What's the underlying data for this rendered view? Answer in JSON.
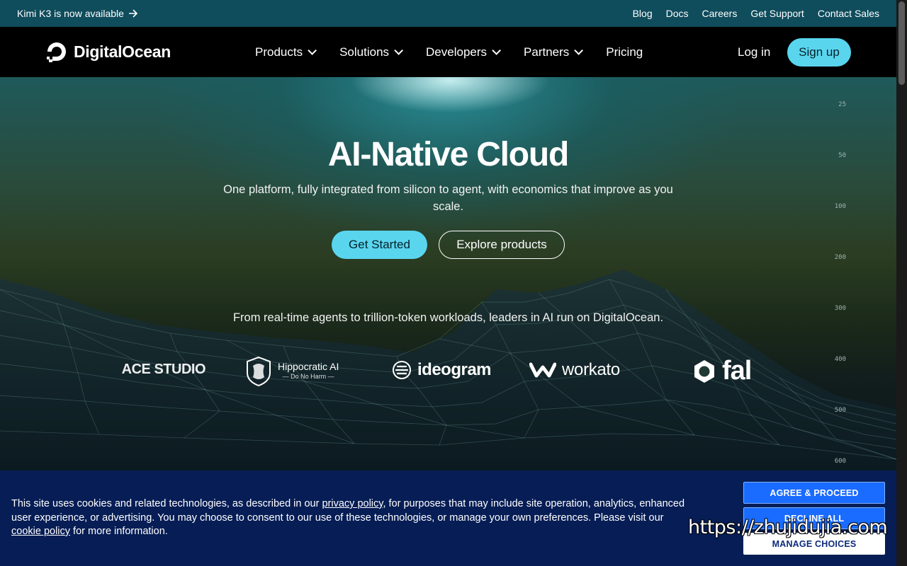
{
  "announcement": {
    "text": "Kimi K3 is now available",
    "arrow_icon": "arrow-right-icon",
    "links": [
      "Blog",
      "Docs",
      "Careers",
      "Get Support",
      "Contact Sales"
    ]
  },
  "nav": {
    "brand": "DigitalOcean",
    "items": [
      {
        "label": "Products",
        "dropdown": true
      },
      {
        "label": "Solutions",
        "dropdown": true
      },
      {
        "label": "Developers",
        "dropdown": true
      },
      {
        "label": "Partners",
        "dropdown": true
      },
      {
        "label": "Pricing",
        "dropdown": false
      }
    ],
    "login": "Log in",
    "signup": "Sign up"
  },
  "hero": {
    "title": "AI-Native Cloud",
    "subtitle": "One platform, fully integrated from silicon to agent, with economics that improve as you scale.",
    "primary_cta": "Get Started",
    "secondary_cta": "Explore products",
    "leaders_text": "From real-time agents to trillion-token workloads, leaders in AI run on DigitalOcean."
  },
  "customer_logos": {
    "ace": "ACE STUDIO",
    "hippocratic_name": "Hippocratic AI",
    "hippocratic_tag": "— Do No Harm —",
    "ideogram": "ideogram",
    "workato": "workato",
    "fal": "fal"
  },
  "ruler_labels": [
    "25",
    "50",
    "100",
    "200",
    "300",
    "400",
    "500",
    "600"
  ],
  "cookie": {
    "text_before": "This site uses cookies and related technologies, as described in our ",
    "privacy_link": "privacy policy",
    "text_middle": ", for purposes that may include site operation, analytics, enhanced user experience, or advertising. You may choose to consent to our use of these technologies, or manage your own preferences. Please visit our ",
    "cookie_link": "cookie policy",
    "text_after": " for more information.",
    "agree": "AGREE & PROCEED",
    "decline": "DECLINE ALL",
    "manage": "MANAGE CHOICES"
  },
  "watermark": "https://zhujidujia.com",
  "colors": {
    "accent": "#5ad5ee",
    "announcement_bg": "#0f4c5c",
    "cookie_bg": "#061d55",
    "cookie_button": "#1a6bff"
  }
}
